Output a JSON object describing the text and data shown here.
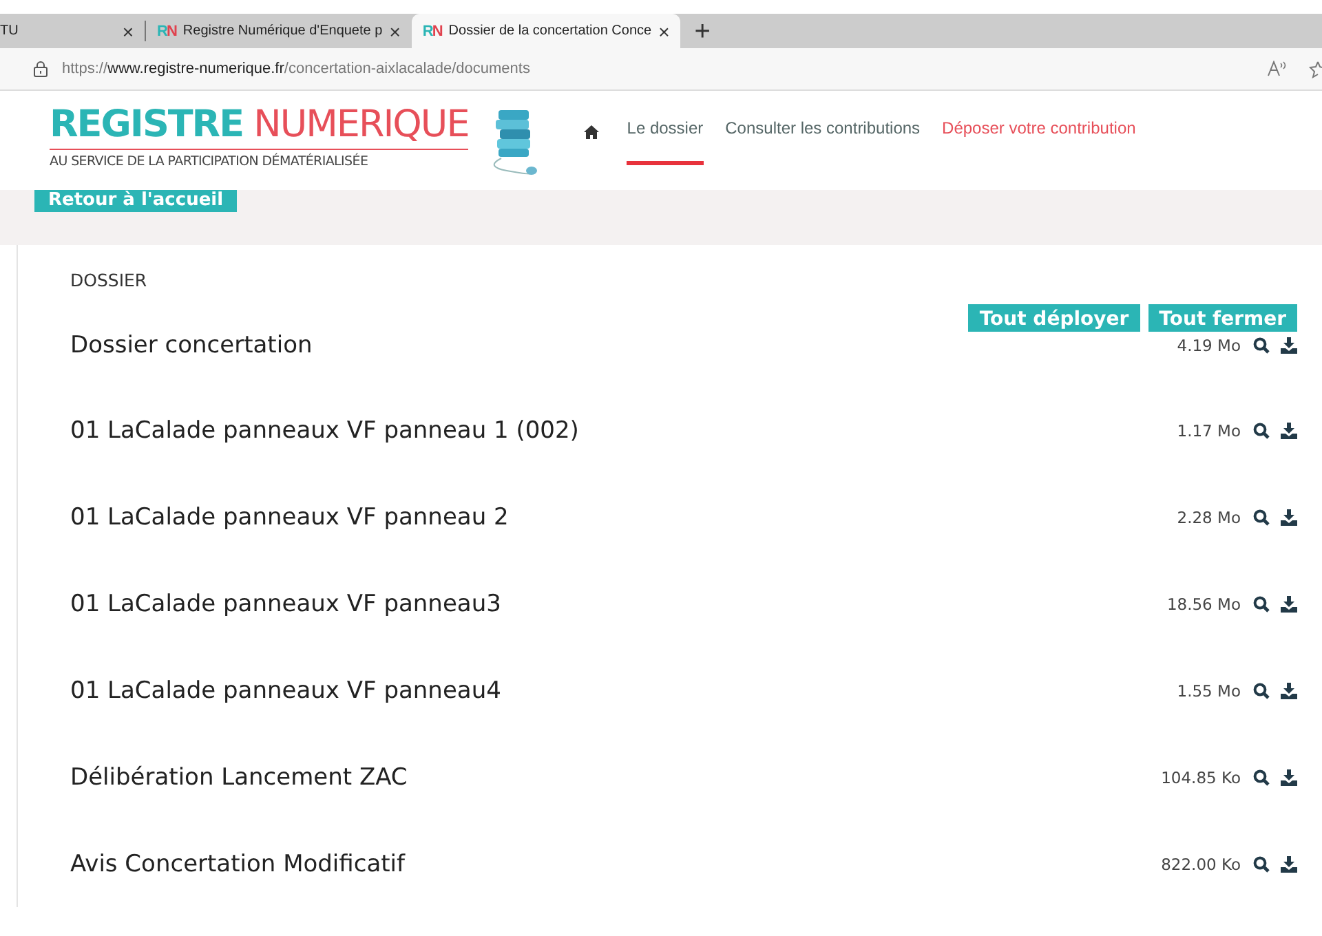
{
  "browser": {
    "tabs": [
      {
        "title": "TU",
        "selected": false,
        "close": "×"
      },
      {
        "favicon": [
          "R",
          "N"
        ],
        "title": "Registre Numérique d'Enquete p",
        "selected": false,
        "close": "×"
      },
      {
        "favicon": [
          "R",
          "N"
        ],
        "title": "Dossier de la concertation Conce",
        "selected": true,
        "close": "×"
      }
    ],
    "new_tab": "+",
    "url": {
      "scheme": "https://",
      "host": "www.registre-numerique.fr",
      "path": "/concertation-aixlacalade/documents"
    }
  },
  "site": {
    "logo": {
      "word1": "REGISTRE",
      "word2": "NUMERIQUE",
      "tagline": "AU SERVICE DE LA PARTICIPATION DÉMATÉRIALISÉE"
    },
    "nav": [
      {
        "label": "Le dossier",
        "selected": true,
        "kind": "normal"
      },
      {
        "label": "Consulter les contributions",
        "selected": false,
        "kind": "normal"
      },
      {
        "label": "Déposer votre contribution",
        "selected": false,
        "kind": "accent"
      }
    ],
    "back_button": "Retour à l'accueil"
  },
  "dossier": {
    "heading": "DOSSIER",
    "buttons": [
      "Tout déployer",
      "Tout fermer"
    ],
    "documents": [
      {
        "title": "Dossier concertation",
        "size": "4.19 Mo"
      },
      {
        "title": "01 LaCalade panneaux VF panneau 1 (002)",
        "size": "1.17 Mo"
      },
      {
        "title": "01 LaCalade panneaux VF panneau 2",
        "size": "2.28 Mo"
      },
      {
        "title": "01 LaCalade panneaux VF panneau3",
        "size": "18.56 Mo"
      },
      {
        "title": "01 LaCalade panneaux VF panneau4",
        "size": "1.55 Mo"
      },
      {
        "title": "Délibération Lancement ZAC",
        "size": "104.85 Ko"
      },
      {
        "title": "Avis Concertation Modificatif",
        "size": "822.00 Ko"
      }
    ]
  }
}
